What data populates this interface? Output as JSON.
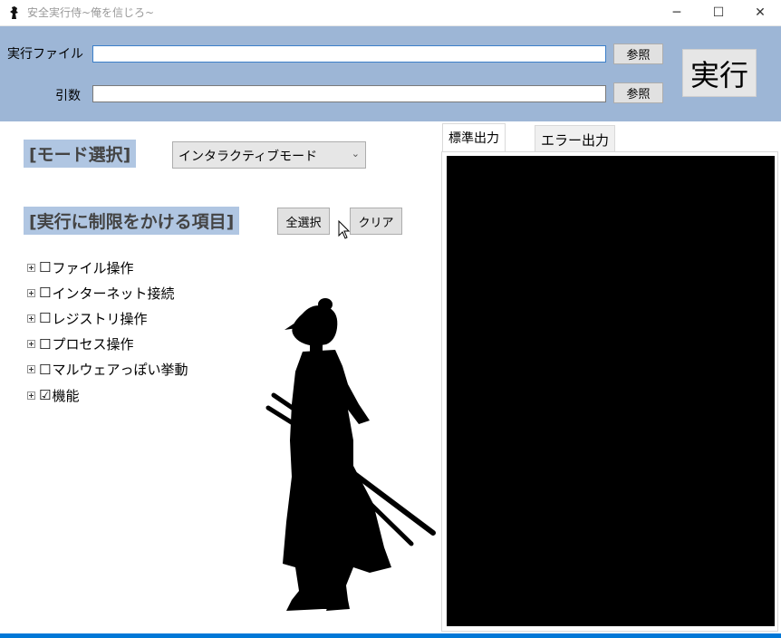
{
  "window": {
    "title": "安全実行侍~俺を信じろ~",
    "minimize_glyph": "─",
    "maximize_glyph": "☐",
    "close_glyph": "✕"
  },
  "header": {
    "exe_label": "実行ファイル",
    "exe_value": "",
    "args_label": "引数",
    "args_value": "",
    "browse_label": "参照",
    "run_label": "実行"
  },
  "mode": {
    "title": "[モード選択]",
    "selected": "インタラクティブモード"
  },
  "restrictions": {
    "title": "[実行に制限をかける項目]",
    "select_all_label": "全選択",
    "clear_label": "クリア",
    "items": [
      {
        "label": "ファイル操作",
        "check": "☐"
      },
      {
        "label": "インターネット接続",
        "check": "☐"
      },
      {
        "label": "レジストリ操作",
        "check": "☐"
      },
      {
        "label": "プロセス操作",
        "check": "☐"
      },
      {
        "label": "マルウェアっぽい挙動",
        "check": "☐"
      },
      {
        "label": "機能",
        "check": "☑"
      }
    ]
  },
  "output": {
    "tab_stdout": "標準出力",
    "tab_stderr": "エラー出力"
  },
  "icons": {
    "app": "samurai-icon",
    "expander": "tree-expand-icon",
    "cursor": "mouse-pointer-icon"
  },
  "colors": {
    "header_bg": "#9db6d6",
    "section_title_bg": "#b0c6e2",
    "console_bg": "#000000",
    "taskbar_accent": "#0078d7"
  }
}
